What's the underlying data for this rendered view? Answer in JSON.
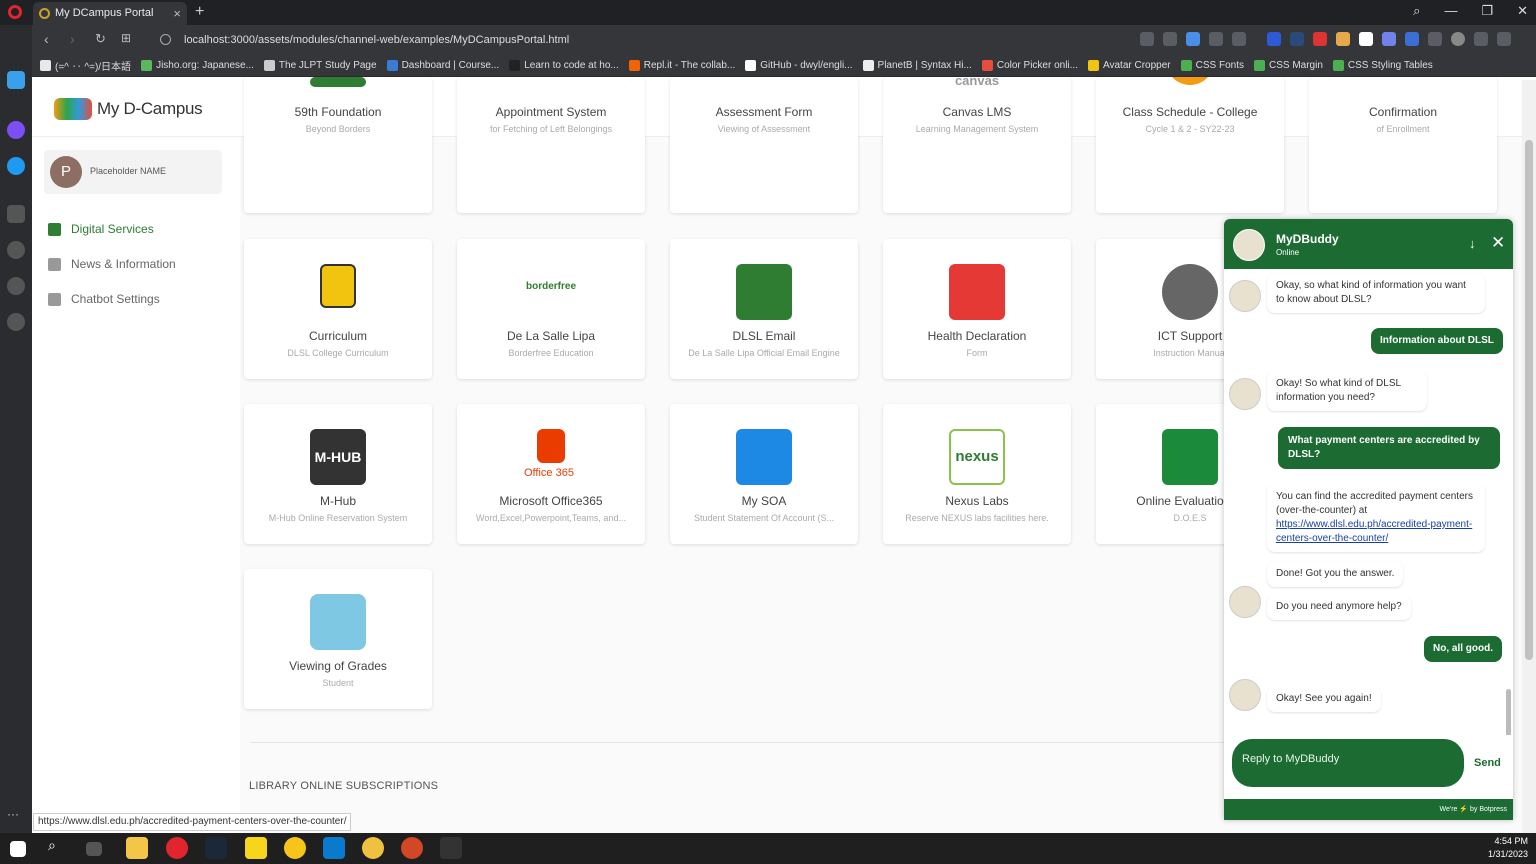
{
  "browser": {
    "tab_title": "My DCampus Portal",
    "url": "localhost:3000/assets/modules/channel-web/examples/MyDCampusPortal.html",
    "bookmarks": [
      {
        "label": "(=^ ‥ ^=)/日本語",
        "color": "#e8e8e8"
      },
      {
        "label": "Jisho.org: Japanese...",
        "color": "#5cb85c"
      },
      {
        "label": "The JLPT Study Page",
        "color": "#cccccc"
      },
      {
        "label": "Dashboard | Course...",
        "color": "#3a7bd5"
      },
      {
        "label": "Learn to code at ho...",
        "color": "#222222"
      },
      {
        "label": "Repl.it - The collab...",
        "color": "#f26207"
      },
      {
        "label": "GitHub - dwyl/engli...",
        "color": "#ffffff"
      },
      {
        "label": "PlanetB | Syntax Hi...",
        "color": "#eeeeee"
      },
      {
        "label": "Color Picker onli...",
        "color": "#e74c3c"
      },
      {
        "label": "Avatar Cropper",
        "color": "#f1c40f"
      },
      {
        "label": "CSS Fonts",
        "color": "#4caf50"
      },
      {
        "label": "CSS Margin",
        "color": "#4caf50"
      },
      {
        "label": "CSS Styling Tables",
        "color": "#4caf50"
      }
    ],
    "status_url": "https://www.dlsl.edu.ph/accredited-payment-centers-over-the-counter/"
  },
  "app": {
    "brand": "My D-Campus",
    "user_initial": "P",
    "user_name": "Placeholder NAME",
    "nav": [
      {
        "label": "Digital Services",
        "active": true
      },
      {
        "label": "News & Information",
        "active": false
      },
      {
        "label": "Chatbot Settings",
        "active": false
      }
    ],
    "top_row": [
      {
        "name": "59th Foundation",
        "sub": "Beyond Borders"
      },
      {
        "name": "Appointment System",
        "sub": "for Fetching of Left Belongings"
      },
      {
        "name": "Assessment Form",
        "sub": "Viewing of Assessment"
      },
      {
        "name": "Canvas LMS",
        "sub": "Learning Management System"
      },
      {
        "name": "Class Schedule - College",
        "sub": "Cycle 1 & 2 - SY22-23"
      },
      {
        "name": "Confirmation",
        "sub": "of Enrollment"
      }
    ],
    "cards": [
      {
        "name": "Curriculum",
        "sub": "DLSL College Curriculum",
        "color": "#f1c40f"
      },
      {
        "name": "De La Salle Lipa",
        "sub": "Borderfree Education",
        "color": "#e8f5e9"
      },
      {
        "name": "DLSL Email",
        "sub": "De La Salle Lipa Official Email Engine",
        "color": "#2e7d32"
      },
      {
        "name": "Health Declaration",
        "sub": "Form",
        "color": "#e53935"
      },
      {
        "name": "ICT Support",
        "sub": "Instruction Manual",
        "color": "#555555"
      },
      {
        "name": "M-Hub",
        "sub": "M-Hub Online Reservation System",
        "color": "#333333"
      },
      {
        "name": "Microsoft Office365",
        "sub": "Word,Excel,Powerpoint,Teams, and...",
        "color": "#eb3c00"
      },
      {
        "name": "My SOA",
        "sub": "Student Statement Of Account (S...",
        "color": "#1e88e5"
      },
      {
        "name": "Nexus Labs",
        "sub": "Reserve NEXUS labs facilities here.",
        "color": "#8bc34a"
      },
      {
        "name": "Online Evaluation of",
        "sub": "D.O.E.S",
        "color": "#1b8a3a"
      },
      {
        "name": "Viewing of Grades",
        "sub": "Student",
        "color": "#7ec8e3"
      }
    ],
    "library_heading": "LIBRARY ONLINE SUBSCRIPTIONS"
  },
  "chat": {
    "bot_name": "MyDBuddy",
    "status": "Online",
    "messages": [
      {
        "from": "bot",
        "text": "Okay, so what kind of information you want to know about DLSL?"
      },
      {
        "from": "user",
        "text": "Information about DLSL"
      },
      {
        "from": "bot",
        "text": "Okay! So what kind of DLSL information you need?"
      },
      {
        "from": "user",
        "text": "What payment centers are accredited by DLSL?"
      },
      {
        "from": "bot",
        "text": "You can find the accredited payment centers (over-the-counter) at",
        "link": "https://www.dlsl.edu.ph/accredited-payment-centers-over-the-counter/"
      },
      {
        "from": "bot",
        "text": "Done! Got you the answer."
      },
      {
        "from": "bot",
        "text": "Do you need anymore help?"
      },
      {
        "from": "user",
        "text": "No, all good."
      },
      {
        "from": "bot",
        "text": "Okay! See you again!"
      }
    ],
    "placeholder": "Reply to MyDBuddy",
    "send_label": "Send",
    "footer": "We're ⚡ by Botpress"
  },
  "taskbar": {
    "time": "4:54 PM",
    "date": "1/31/2023"
  }
}
